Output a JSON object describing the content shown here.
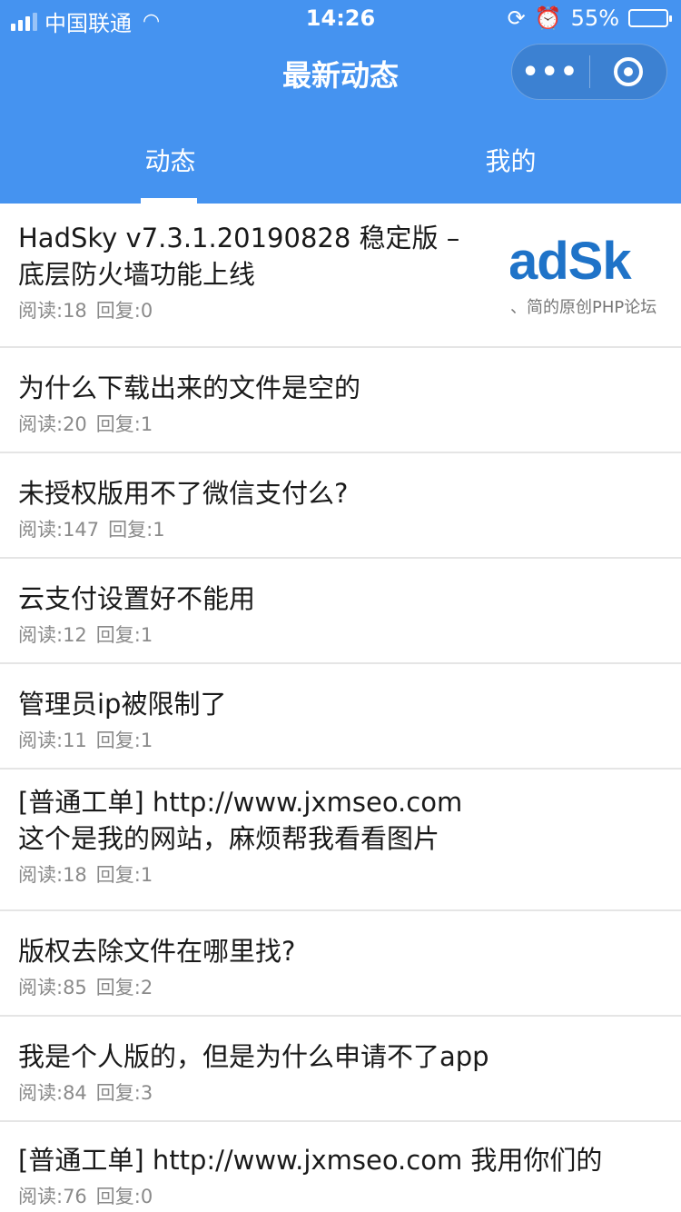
{
  "status_bar": {
    "carrier": "中国联通",
    "time": "14:26",
    "battery": "55%",
    "battery_level": 0.55
  },
  "nav": {
    "title": "最新动态",
    "capsule_more": "•••"
  },
  "tabs": [
    {
      "label": "动态",
      "active": true
    },
    {
      "label": "我的",
      "active": false
    }
  ],
  "posts": [
    {
      "title": "HadSky v7.3.1.20190828 稳定版 –\n底层防火墙功能上线",
      "read": "阅读:18",
      "reply": "回复:0",
      "thumb_logo": "adSk",
      "thumb_tag": "、简的原创PHP论坛"
    },
    {
      "title": "为什么下载出来的文件是空的",
      "read": "阅读:20",
      "reply": "回复:1"
    },
    {
      "title": "未授权版用不了微信支付么?",
      "read": "阅读:147",
      "reply": "回复:1"
    },
    {
      "title": "云支付设置好不能用",
      "read": "阅读:12",
      "reply": "回复:1"
    },
    {
      "title": "管理员ip被限制了",
      "read": "阅读:11",
      "reply": "回复:1"
    },
    {
      "title": "[普通工单] http://www.jxmseo.com\n这个是我的网站，麻烦帮我看看图片",
      "read": "阅读:18",
      "reply": "回复:1"
    },
    {
      "title": "版权去除文件在哪里找?",
      "read": "阅读:85",
      "reply": "回复:2"
    },
    {
      "title": "我是个人版的，但是为什么申请不了app",
      "read": "阅读:84",
      "reply": "回复:3"
    },
    {
      "title": "[普通工单] http://www.jxmseo.com 我用你们的",
      "read": "阅读:76",
      "reply": "回复:0"
    }
  ]
}
